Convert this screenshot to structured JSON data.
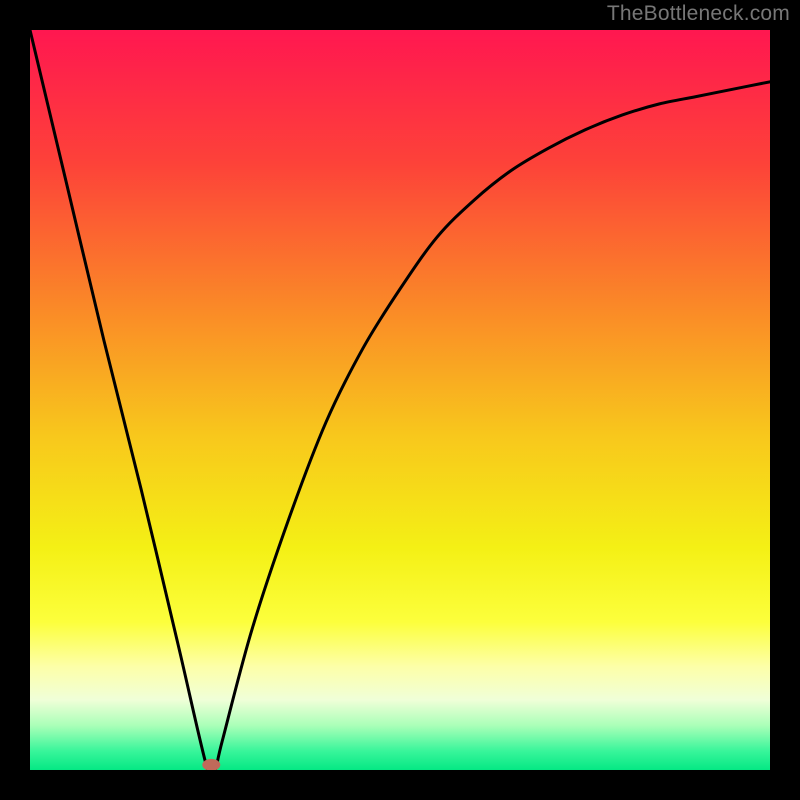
{
  "attribution": "TheBottleneck.com",
  "chart_data": {
    "type": "line",
    "title": "",
    "xlabel": "",
    "ylabel": "",
    "xlim": [
      0,
      100
    ],
    "ylim": [
      0,
      100
    ],
    "grid": false,
    "legend": false,
    "series": [
      {
        "name": "curve",
        "x": [
          0,
          5,
          10,
          15,
          20,
          24,
          25,
          26,
          30,
          35,
          40,
          45,
          50,
          55,
          60,
          65,
          70,
          75,
          80,
          85,
          90,
          95,
          100
        ],
        "y": [
          100,
          79,
          58,
          38,
          17,
          0,
          0,
          4,
          19,
          34,
          47,
          57,
          65,
          72,
          77,
          81,
          84,
          86.5,
          88.5,
          90,
          91,
          92,
          93
        ]
      }
    ],
    "marker": {
      "x": 24.5,
      "y": 0.7,
      "color": "#c06a5a"
    },
    "gradient_stops": [
      {
        "offset": 0.0,
        "color": "#ff1750"
      },
      {
        "offset": 0.18,
        "color": "#fd4239"
      },
      {
        "offset": 0.38,
        "color": "#fa8b27"
      },
      {
        "offset": 0.55,
        "color": "#f8c81c"
      },
      {
        "offset": 0.7,
        "color": "#f4f015"
      },
      {
        "offset": 0.8,
        "color": "#fcff3c"
      },
      {
        "offset": 0.86,
        "color": "#fdffa8"
      },
      {
        "offset": 0.905,
        "color": "#f0ffd8"
      },
      {
        "offset": 0.94,
        "color": "#aaffb8"
      },
      {
        "offset": 0.975,
        "color": "#37f59a"
      },
      {
        "offset": 1.0,
        "color": "#05e884"
      }
    ]
  }
}
